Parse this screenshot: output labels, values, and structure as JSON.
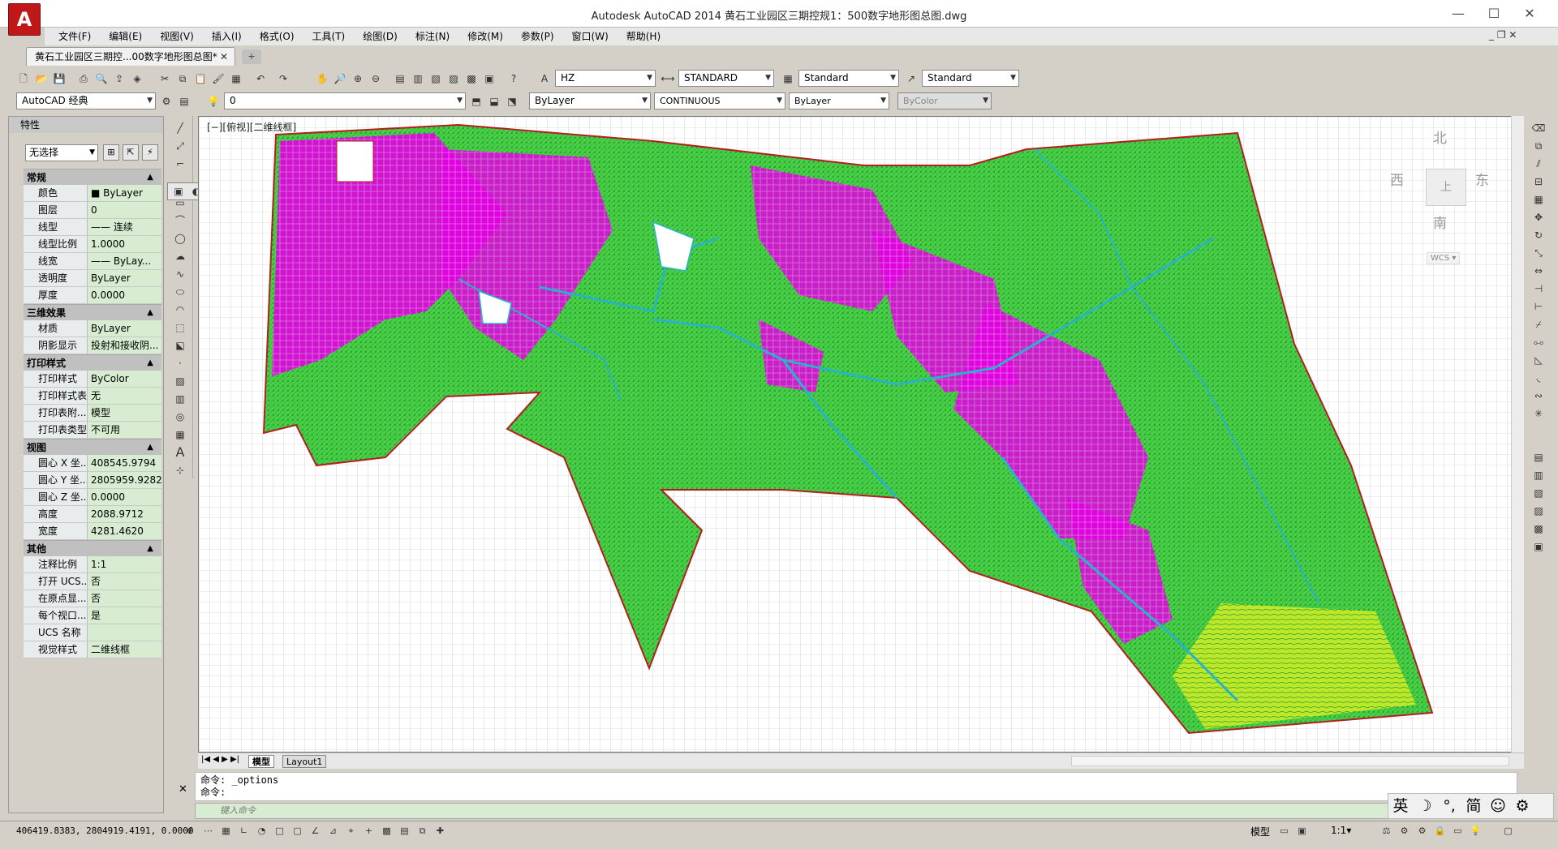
{
  "window": {
    "title": "Autodesk AutoCAD 2014    黄石工业园区三期控规1：500数字地形图总图.dwg",
    "min": "—",
    "max": "☐",
    "close": "✕"
  },
  "app_button": "A",
  "menu": [
    "文件(F)",
    "编辑(E)",
    "视图(V)",
    "插入(I)",
    "格式(O)",
    "工具(T)",
    "绘图(D)",
    "标注(N)",
    "修改(M)",
    "参数(P)",
    "窗口(W)",
    "帮助(H)"
  ],
  "mdi_controls": "_ ❐ ✕",
  "doc_tab": {
    "label": "黄石工业园区三期控...00数字地形图总图*",
    "close": "✕"
  },
  "toolbar1": {
    "text_style_value": "HZ",
    "dim_style_value": "STANDARD",
    "table_style_value": "Standard",
    "mleader_style_value": "Standard"
  },
  "toolbar2": {
    "workspace_value": "AutoCAD 经典",
    "layer_value": "0",
    "color_value": "ByLayer",
    "linetype_value": "CONTINUOUS",
    "lineweight_value": "ByLayer",
    "plotstyle_value": "ByColor"
  },
  "properties": {
    "title": "特性",
    "selection": "无选择",
    "sections": [
      {
        "name": "常规",
        "rows": [
          {
            "k": "颜色",
            "v": "■ ByLayer"
          },
          {
            "k": "图层",
            "v": "0"
          },
          {
            "k": "线型",
            "v": "—— 连续"
          },
          {
            "k": "线型比例",
            "v": "1.0000"
          },
          {
            "k": "线宽",
            "v": "—— ByLay..."
          },
          {
            "k": "透明度",
            "v": "ByLayer"
          },
          {
            "k": "厚度",
            "v": "0.0000"
          }
        ]
      },
      {
        "name": "三维效果",
        "rows": [
          {
            "k": "材质",
            "v": "ByLayer"
          },
          {
            "k": "阴影显示",
            "v": "投射和接收阴..."
          }
        ]
      },
      {
        "name": "打印样式",
        "rows": [
          {
            "k": "打印样式",
            "v": "ByColor"
          },
          {
            "k": "打印样式表",
            "v": "无"
          },
          {
            "k": "打印表附...",
            "v": "模型"
          },
          {
            "k": "打印表类型",
            "v": "不可用"
          }
        ]
      },
      {
        "name": "视图",
        "rows": [
          {
            "k": "圆心 X 坐...",
            "v": "408545.9794"
          },
          {
            "k": "圆心 Y 坐...",
            "v": "2805959.9282"
          },
          {
            "k": "圆心 Z 坐...",
            "v": "0.0000"
          },
          {
            "k": "高度",
            "v": "2088.9712"
          },
          {
            "k": "宽度",
            "v": "4281.4620"
          }
        ]
      },
      {
        "name": "其他",
        "rows": [
          {
            "k": "注释比例",
            "v": "1:1"
          },
          {
            "k": "打开 UCS...",
            "v": "否"
          },
          {
            "k": "在原点显...",
            "v": "否"
          },
          {
            "k": "每个视口...",
            "v": "是"
          },
          {
            "k": "UCS 名称",
            "v": ""
          },
          {
            "k": "视觉样式",
            "v": "二维线框"
          }
        ]
      }
    ]
  },
  "viewport": {
    "label": "[−][俯视][二维线框]",
    "viewcube": {
      "north": "北",
      "south": "南",
      "east": "东",
      "west": "西",
      "top": "上",
      "wcs": "WCS ▾"
    }
  },
  "layout_tabs": {
    "model": "模型",
    "layout1": "Layout1"
  },
  "command": {
    "line1": "命令: _options",
    "line2": "命令:",
    "placeholder": "键入命令"
  },
  "ime": [
    "英",
    "☽",
    "°,",
    "简",
    "☺",
    "⚙"
  ],
  "status": {
    "coords": "406419.8383,  2804919.4191,  0.0000",
    "model": "模型",
    "annotation_scale": "1:1▾"
  },
  "colors": {
    "accent_red": "#c01818",
    "panel_green": "#d7ecd1",
    "map_magenta": "#e100e1",
    "map_green": "#3fc63f",
    "map_cyan": "#28b4c8",
    "boundary_red": "#b41e1e"
  }
}
